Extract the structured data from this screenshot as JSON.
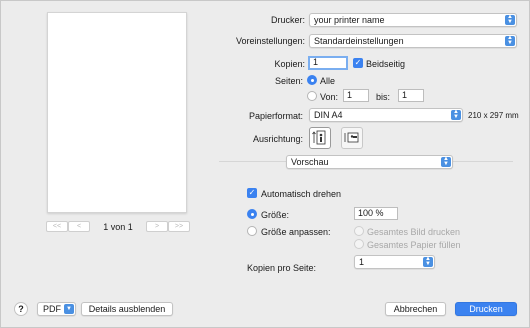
{
  "printer": {
    "label": "Drucker:",
    "value": "your printer name"
  },
  "presets": {
    "label": "Voreinstellungen:",
    "value": "Standardeinstellungen"
  },
  "copies": {
    "label": "Kopien:",
    "value": "1",
    "duplex_label": "Beidseitig",
    "duplex_checked": true
  },
  "pages": {
    "label": "Seiten:",
    "all_label": "Alle",
    "from_label": "Von:",
    "from_value": "1",
    "to_label": "bis:",
    "to_value": "1"
  },
  "paper": {
    "label": "Papierformat:",
    "value": "DIN A4",
    "dimensions": "210 x 297 mm"
  },
  "orientation": {
    "label": "Ausrichtung:"
  },
  "section": {
    "value": "Vorschau"
  },
  "auto_rotate": {
    "label": "Automatisch drehen",
    "checked": true
  },
  "scale": {
    "size_label": "Größe:",
    "size_value": "100 %",
    "fit_label": "Größe anpassen:",
    "fit_whole_label": "Gesamtes Bild drucken",
    "fit_fill_label": "Gesamtes Papier füllen"
  },
  "pages_per_sheet": {
    "label": "Kopien pro Seite:",
    "value": "1"
  },
  "preview_nav": {
    "first": "<<",
    "prev": "<",
    "page_indicator": "1 von 1",
    "next": ">",
    "last": ">>"
  },
  "bottom": {
    "help": "?",
    "pdf": "PDF",
    "hide_details": "Details ausblenden",
    "cancel": "Abbrechen",
    "print": "Drucken"
  },
  "colors": {
    "accent": "#3b82f0",
    "background": "#ececec"
  }
}
